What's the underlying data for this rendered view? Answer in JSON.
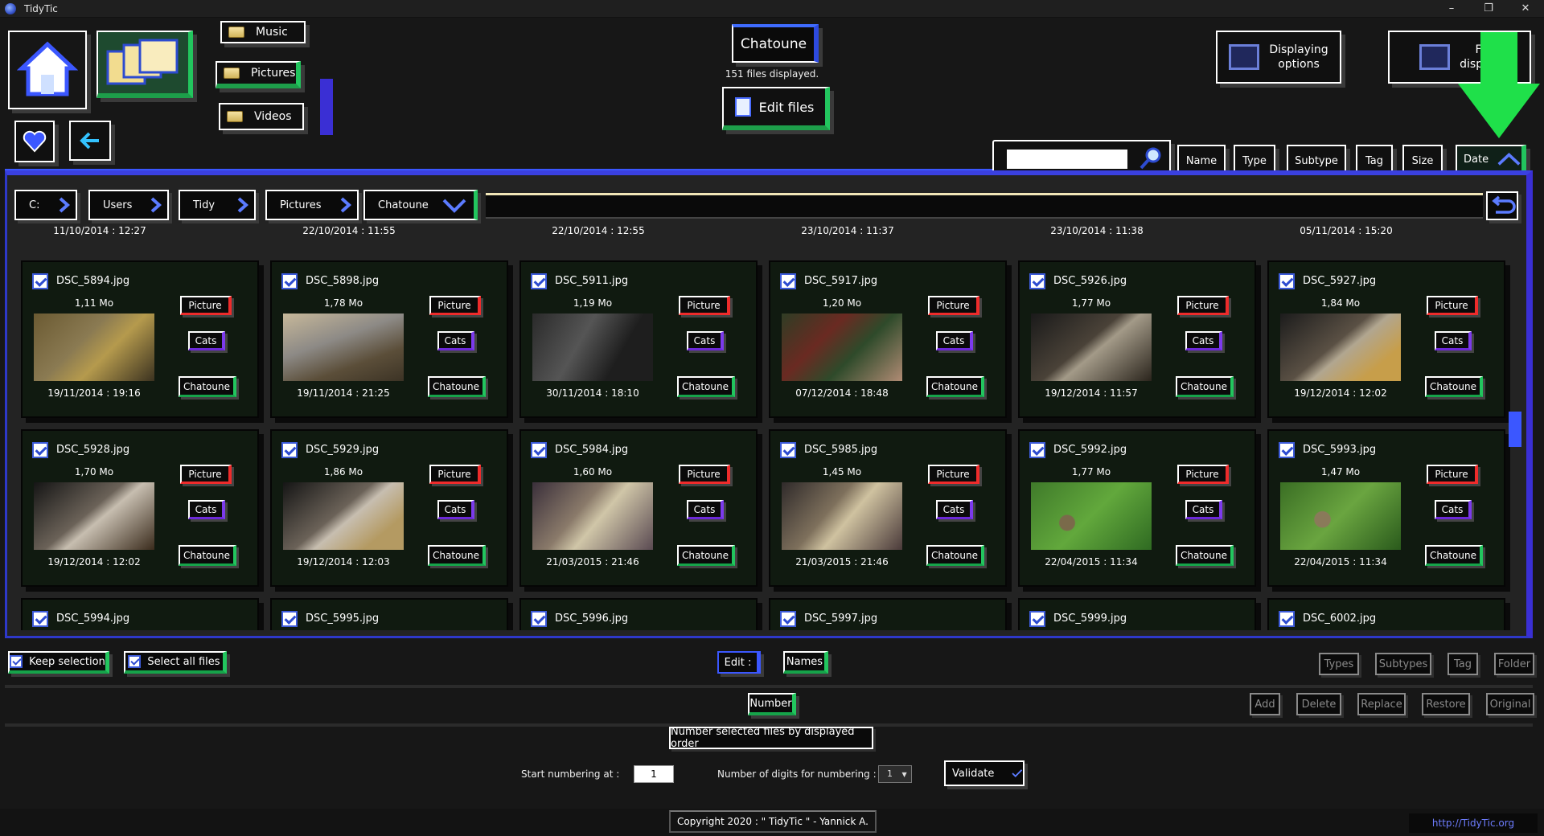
{
  "window": {
    "title": "TidyTic",
    "controls": [
      "–",
      "❐",
      "✕"
    ]
  },
  "nav": {
    "music": "Music",
    "pictures": "Pictures",
    "videos": "Videos"
  },
  "folder": {
    "name": "Chatoune",
    "count_text": "151 files displayed.",
    "edit_label": "Edit files"
  },
  "display": {
    "options_label_1": "Displaying",
    "options_label_2": "options",
    "files_label_1": "Fi",
    "files_label_2": "display"
  },
  "sort": {
    "name": "Name",
    "type": "Type",
    "subtype": "Subtype",
    "tag": "Tag",
    "size": "Size",
    "date": "Date"
  },
  "breadcrumb": [
    "C:",
    "Users",
    "Tidy",
    "Pictures",
    "Chatoune"
  ],
  "top_row_dates": [
    "11/10/2014 : 12:27",
    "22/10/2014 : 11:55",
    "22/10/2014 : 12:55",
    "23/10/2014 : 11:37",
    "23/10/2014 : 11:38",
    "05/11/2014 : 15:20"
  ],
  "tags": {
    "type": "Picture",
    "subtype": "Cats",
    "tag": "Chatoune"
  },
  "files_row1": [
    {
      "name": "DSC_5894.jpg",
      "size": "1,11 Mo",
      "date": "19/11/2014 : 19:16"
    },
    {
      "name": "DSC_5898.jpg",
      "size": "1,78 Mo",
      "date": "19/11/2014 : 21:25"
    },
    {
      "name": "DSC_5911.jpg",
      "size": "1,19 Mo",
      "date": "30/11/2014 : 18:10"
    },
    {
      "name": "DSC_5917.jpg",
      "size": "1,20 Mo",
      "date": "07/12/2014 : 18:48"
    },
    {
      "name": "DSC_5926.jpg",
      "size": "1,77 Mo",
      "date": "19/12/2014 : 11:57"
    },
    {
      "name": "DSC_5927.jpg",
      "size": "1,84 Mo",
      "date": "19/12/2014 : 12:02"
    }
  ],
  "files_row2": [
    {
      "name": "DSC_5928.jpg",
      "size": "1,70 Mo",
      "date": "19/12/2014 : 12:02"
    },
    {
      "name": "DSC_5929.jpg",
      "size": "1,86 Mo",
      "date": "19/12/2014 : 12:03"
    },
    {
      "name": "DSC_5984.jpg",
      "size": "1,60 Mo",
      "date": "21/03/2015 : 21:46"
    },
    {
      "name": "DSC_5985.jpg",
      "size": "1,45 Mo",
      "date": "21/03/2015 : 21:46"
    },
    {
      "name": "DSC_5992.jpg",
      "size": "1,77 Mo",
      "date": "22/04/2015 : 11:34"
    },
    {
      "name": "DSC_5993.jpg",
      "size": "1,47 Mo",
      "date": "22/04/2015 : 11:34"
    }
  ],
  "files_row3": [
    "DSC_5994.jpg",
    "DSC_5995.jpg",
    "DSC_5996.jpg",
    "DSC_5997.jpg",
    "DSC_5999.jpg",
    "DSC_6002.jpg"
  ],
  "bottom": {
    "keep_selection": "Keep selection",
    "select_all": "Select all files",
    "edit": "Edit :",
    "names": "Names",
    "types": "Types",
    "subtypes": "Subtypes",
    "tag": "Tag",
    "folder": "Folder",
    "number": "Number",
    "add": "Add",
    "delete": "Delete",
    "replace": "Replace",
    "restore": "Restore",
    "original": "Original",
    "number_desc": "Number selected files by displayed order",
    "start_label": "Start numbering at :",
    "start_value": "1",
    "digits_label": "Number of digits for numbering :",
    "digits_value": "1",
    "validate": "Validate"
  },
  "footer": {
    "copyright": "Copyright 2020 : \" TidyTic \" - Yannick A.",
    "link": "http://TidyTic.org"
  },
  "colors": {
    "accent_blue": "#3b57ff",
    "accent_green": "#22c55e",
    "accent_red": "#ef2b2b",
    "panel_bg": "#232323"
  }
}
